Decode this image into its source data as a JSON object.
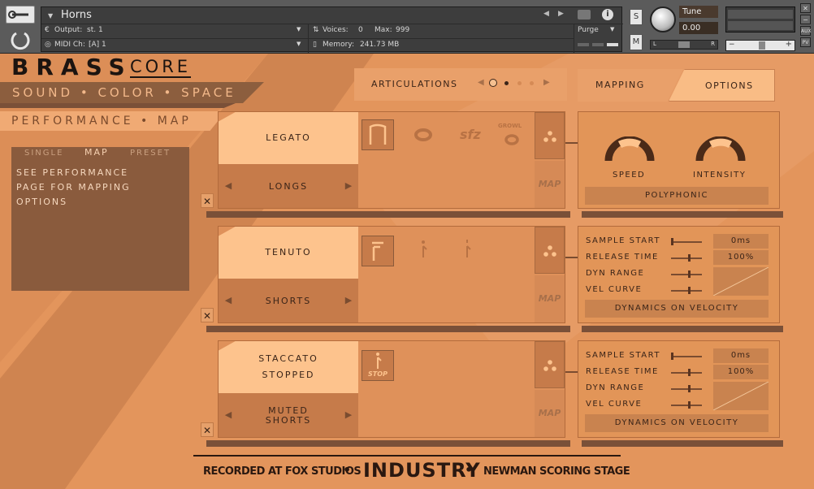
{
  "header": {
    "instrument_name": "Horns",
    "output_label": "Output:",
    "output_value": "st. 1",
    "midi_label": "MIDI Ch:",
    "midi_value": "[A] 1",
    "voices_label": "Voices:",
    "voices_value": "0",
    "max_label": "Max:",
    "max_value": "999",
    "memory_label": "Memory:",
    "memory_value": "241.73 MB",
    "purge_label": "Purge",
    "tune_label": "Tune",
    "tune_value": "0.00",
    "s_label": "S",
    "m_label": "M",
    "pan_left": "L",
    "pan_right": "R",
    "aux_label": "AUX",
    "pv_label": "PV"
  },
  "brand": {
    "title_left": "BRASS",
    "title_right": "CORE",
    "subtitle": "SOUND • COLOR • SPACE"
  },
  "left_menu": {
    "performance_map": "PERFORMANCE • MAP",
    "tabs": [
      "SINGLE",
      "MAP",
      "PRESET"
    ],
    "info_lines": [
      "SEE PERFORMANCE",
      "PAGE FOR MAPPING",
      "OPTIONS"
    ]
  },
  "articulations": {
    "label": "ARTICULATIONS"
  },
  "right_tabs": {
    "mapping": "MAPPING",
    "options": "OPTIONS"
  },
  "slot1": {
    "name": "LEGATO",
    "category": "LONGS",
    "icons": [
      "sfz",
      "GROWL"
    ],
    "map_label": "MAP"
  },
  "slot2": {
    "name": "TENUTO",
    "category": "SHORTS",
    "map_label": "MAP"
  },
  "slot3": {
    "name_line1": "STACCATO",
    "name_line2": "STOPPED",
    "category_line1": "MUTED",
    "category_line2": "SHORTS",
    "stop_label": "STOP",
    "map_label": "MAP"
  },
  "options1": {
    "speed": "SPEED",
    "intensity": "INTENSITY",
    "mode": "POLYPHONIC",
    "speed_level": 0.5,
    "intensity_level": 0.5
  },
  "options2": {
    "rows": [
      {
        "label": "SAMPLE START",
        "value": "0ms",
        "level": 0.0
      },
      {
        "label": "RELEASE TIME",
        "value": "100%",
        "level": 0.55
      },
      {
        "label": "DYN RANGE",
        "value": "",
        "level": 0.55
      },
      {
        "label": "VEL CURVE",
        "value": "",
        "level": 0.55
      }
    ],
    "button": "DYNAMICS ON VELOCITY"
  },
  "options3": {
    "rows": [
      {
        "label": "SAMPLE START",
        "value": "0ms",
        "level": 0.0
      },
      {
        "label": "RELEASE TIME",
        "value": "100%",
        "level": 0.55
      },
      {
        "label": "DYN RANGE",
        "value": "",
        "level": 0.55
      },
      {
        "label": "VEL CURVE",
        "value": "",
        "level": 0.55
      }
    ],
    "button": "DYNAMICS ON VELOCITY"
  },
  "footer": {
    "left": "RECORDED AT FOX STUDIOS",
    "center": "INDUSTRY",
    "right": "NEWMAN SCORING STAGE"
  },
  "colors": {
    "background": "#e3955c",
    "dark_strip": "#8c5e3e",
    "light_button": "#fdc38d",
    "header": "#5b5b5b"
  }
}
